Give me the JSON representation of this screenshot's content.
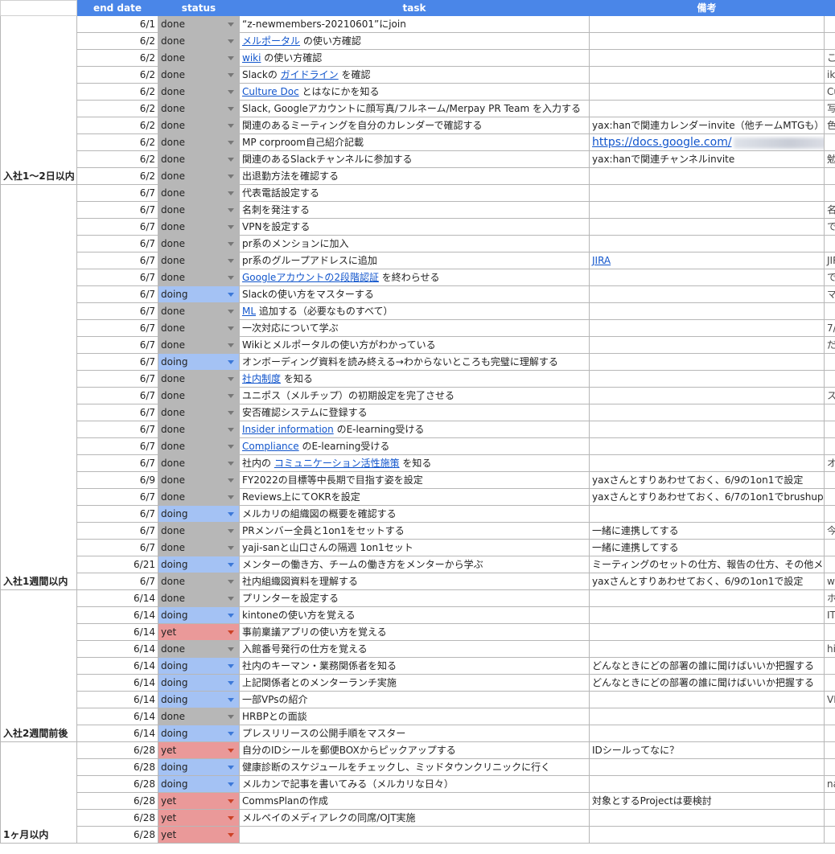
{
  "headers": {
    "end_date": "end date",
    "status": "status",
    "task": "task",
    "note": "備考"
  },
  "colors": {
    "header": "#4a86e8",
    "done": "#b7b7b7",
    "doing": "#a4c2f4",
    "yet": "#ea9999",
    "link": "#1155cc"
  },
  "groups": [
    {
      "label": "入社1〜2日以内",
      "rows": [
        {
          "date": "6/1",
          "status": "done",
          "task": [
            {
              "t": "“z-newmembers-20210601”にjoin"
            }
          ],
          "note": "",
          "extra": ""
        },
        {
          "date": "6/2",
          "status": "done",
          "task": [
            {
              "t": "メルポータル",
              "link": true
            },
            {
              "t": " の使い方確認"
            }
          ],
          "note": "",
          "extra": ""
        },
        {
          "date": "6/2",
          "status": "done",
          "task": [
            {
              "t": "wiki",
              "link": true
            },
            {
              "t": " の使い方確認"
            }
          ],
          "note": "",
          "extra": "こ"
        },
        {
          "date": "6/2",
          "status": "done",
          "task": [
            {
              "t": "Slackの "
            },
            {
              "t": "ガイドライン",
              "link": true
            },
            {
              "t": " を確認"
            }
          ],
          "note": "",
          "extra": "iku"
        },
        {
          "date": "6/2",
          "status": "done",
          "task": [
            {
              "t": " Culture Doc",
              "link": true
            },
            {
              "t": " とはなにかを知る"
            }
          ],
          "note": "",
          "extra": "Cu"
        },
        {
          "date": "6/2",
          "status": "done",
          "task": [
            {
              "t": "Slack, Googleアカウントに顔写真/フルネーム/Merpay PR Team を入力する"
            }
          ],
          "note": "",
          "extra": "写"
        },
        {
          "date": "6/2",
          "status": "done",
          "task": [
            {
              "t": "関連のあるミーティングを自分のカレンダーで確認する"
            }
          ],
          "note": "yax:hanで関連カレンダーinvite（他チームMTGも）",
          "extra": "色"
        },
        {
          "date": "6/2",
          "status": "done",
          "task": [
            {
              "t": "MP corproom自己紹介記載"
            }
          ],
          "note_link": "https://docs.google.com/",
          "note": "",
          "extra": ""
        },
        {
          "date": "6/2",
          "status": "done",
          "task": [
            {
              "t": "関連のあるSlackチャンネルに参加する"
            }
          ],
          "note": "yax:hanで関連チャンネルinvite",
          "extra": "勉"
        },
        {
          "date": "6/2",
          "status": "done",
          "task": [
            {
              "t": "出退勤方法を確認する"
            }
          ],
          "note": "",
          "extra": ""
        }
      ]
    },
    {
      "label": "入社1週間以内",
      "rows": [
        {
          "date": "6/7",
          "status": "done",
          "task": [
            {
              "t": "代表電話設定する"
            }
          ],
          "note": "",
          "extra": ""
        },
        {
          "date": "6/7",
          "status": "done",
          "task": [
            {
              "t": "名刺を発注する"
            }
          ],
          "note": "",
          "extra": "名"
        },
        {
          "date": "6/7",
          "status": "done",
          "task": [
            {
              "t": "VPNを設定する"
            }
          ],
          "note": "",
          "extra": "で"
        },
        {
          "date": "6/7",
          "status": "done",
          "task": [
            {
              "t": "pr系のメンションに加入"
            }
          ],
          "note": "",
          "extra": ""
        },
        {
          "date": "6/7",
          "status": "done",
          "task": [
            {
              "t": "pr系のグループアドレスに追加"
            }
          ],
          "note_link": "JIRA",
          "note": "",
          "extra": "JIR"
        },
        {
          "date": "6/7",
          "status": "done",
          "task": [
            {
              "t": "Googleアカウントの2段階認証",
              "link": true
            },
            {
              "t": " を終わらせる"
            }
          ],
          "note": "",
          "extra": "で"
        },
        {
          "date": "6/7",
          "status": "doing",
          "task": [
            {
              "t": "Slackの使い方をマスターする"
            }
          ],
          "note": "",
          "extra": "マ"
        },
        {
          "date": "6/7",
          "status": "done",
          "task": [
            {
              "t": "ML",
              "link": true
            },
            {
              "t": " 追加する（必要なものすべて）"
            }
          ],
          "note": "",
          "extra": ""
        },
        {
          "date": "6/7",
          "status": "done",
          "task": [
            {
              "t": "一次対応について学ぶ"
            }
          ],
          "note": "",
          "extra": "7/"
        },
        {
          "date": "6/7",
          "status": "done",
          "task": [
            {
              "t": "Wikiとメルポータルの使い方がわかっている"
            }
          ],
          "note": "",
          "extra": "だ"
        },
        {
          "date": "6/7",
          "status": "doing",
          "task": [
            {
              "t": "オンボーディング資料を読み終える→わからないところも完璧に理解する"
            }
          ],
          "note": "",
          "extra": ""
        },
        {
          "date": "6/7",
          "status": "done",
          "task": [
            {
              "t": "社内制度",
              "link": true
            },
            {
              "t": " を知る"
            }
          ],
          "note": "",
          "extra": ""
        },
        {
          "date": "6/7",
          "status": "done",
          "task": [
            {
              "t": "ユニポス（メルチップ）の初期設定を完了させる"
            }
          ],
          "note": "",
          "extra": "ス"
        },
        {
          "date": "6/7",
          "status": "done",
          "task": [
            {
              "t": "安否確認システムに登録する"
            }
          ],
          "note": "",
          "extra": ""
        },
        {
          "date": "6/7",
          "status": "done",
          "task": [
            {
              "t": "Insider information",
              "link": true
            },
            {
              "t": " のE-learning受ける"
            }
          ],
          "note": "",
          "extra": ""
        },
        {
          "date": "6/7",
          "status": "done",
          "task": [
            {
              "t": "Compliance",
              "link": true
            },
            {
              "t": " のE-learning受ける"
            }
          ],
          "note": "",
          "extra": ""
        },
        {
          "date": "6/7",
          "status": "done",
          "task": [
            {
              "t": "社内の "
            },
            {
              "t": "コミュニケーション活性施策",
              "link": true
            },
            {
              "t": " を知る"
            }
          ],
          "note": "",
          "extra": "オ"
        },
        {
          "date": "6/9",
          "status": "done",
          "task": [
            {
              "t": "FY2022の目標等中長期で目指す姿を設定"
            }
          ],
          "note": "yaxさんとすりあわせておく、6/9の1on1で設定",
          "extra": ""
        },
        {
          "date": "6/7",
          "status": "done",
          "task": [
            {
              "t": "Reviews上にてOKRを設定"
            }
          ],
          "note": "yaxさんとすりあわせておく、6/7の1on1でbrushup",
          "extra": ""
        },
        {
          "date": "6/7",
          "status": "doing",
          "task": [
            {
              "t": "メルカリの組織図の概要を確認する"
            }
          ],
          "note": "",
          "extra": ""
        },
        {
          "date": "6/7",
          "status": "done",
          "task": [
            {
              "t": "PRメンバー全員と1on1をセットする"
            }
          ],
          "note": "一緒に連携してする",
          "extra": "今"
        },
        {
          "date": "6/7",
          "status": "done",
          "task": [
            {
              "t": "yaji-sanと山口さんの隔週 1on1セット"
            }
          ],
          "note": "一緒に連携してする",
          "extra": ""
        },
        {
          "date": "6/21",
          "status": "doing",
          "tall": true,
          "task": [
            {
              "t": "メンターの働き方、チームの働き方をメンターから学ぶ"
            }
          ],
          "note": "ミーティングのセットの仕方、報告の仕方、その他メンバ",
          "extra": ""
        },
        {
          "date": "6/7",
          "status": "done",
          "task": [
            {
              "t": "社内組織図資料を理解する"
            }
          ],
          "note": "yaxさんとすりあわせておく、6/9の1on1で設定",
          "extra": "wo"
        }
      ]
    },
    {
      "label": "入社2週間前後",
      "rows": [
        {
          "date": "6/14",
          "status": "done",
          "task": [
            {
              "t": "プリンターを設定する"
            }
          ],
          "note": "",
          "extra": "ホ"
        },
        {
          "date": "6/14",
          "status": "doing",
          "task": [
            {
              "t": "kintoneの使い方を覚える"
            }
          ],
          "note": "",
          "extra": "IT"
        },
        {
          "date": "6/14",
          "status": "yet",
          "task": [
            {
              "t": "事前稟議アプリの使い方を覚える"
            }
          ],
          "note": "",
          "extra": ""
        },
        {
          "date": "6/14",
          "status": "done",
          "task": [
            {
              "t": "入館番号発行の仕方を覚える"
            }
          ],
          "note": "",
          "extra": "his"
        },
        {
          "date": "6/14",
          "status": "doing",
          "task": [
            {
              "t": "社内のキーマン・業務関係者を知る"
            }
          ],
          "note": "どんなときにどの部署の誰に聞けばいいか把握する",
          "extra": ""
        },
        {
          "date": "6/14",
          "status": "doing",
          "task": [
            {
              "t": "上記関係者とのメンターランチ実施"
            }
          ],
          "note": "どんなときにどの部署の誰に聞けばいいか把握する",
          "extra": ""
        },
        {
          "date": "6/14",
          "status": "doing",
          "task": [
            {
              "t": "一部VPsの紹介"
            }
          ],
          "note": "",
          "extra": "VP"
        },
        {
          "date": "6/14",
          "status": "done",
          "task": [
            {
              "t": "HRBPとの面談"
            }
          ],
          "note": "",
          "extra": ""
        },
        {
          "date": "6/14",
          "status": "doing",
          "task": [
            {
              "t": "プレスリリースの公開手順をマスター"
            }
          ],
          "note": "",
          "extra": ""
        }
      ]
    },
    {
      "label": "1ヶ月以内",
      "rows": [
        {
          "date": "6/28",
          "status": "yet",
          "task": [
            {
              "t": "自分のIDシールを郵便BOXからピックアップする"
            }
          ],
          "note": "IDシールってなに？",
          "extra": ""
        },
        {
          "date": "6/28",
          "status": "doing",
          "task": [
            {
              "t": "健康診断のスケジュールをチェックし、ミッドタウンクリニックに行く"
            }
          ],
          "note": "",
          "extra": ""
        },
        {
          "date": "6/28",
          "status": "doing",
          "task": [
            {
              "t": "メルカンで記事を書いてみる（メルカリな日々）"
            }
          ],
          "note": "",
          "extra": "na"
        },
        {
          "date": "6/28",
          "status": "yet",
          "task": [
            {
              "t": "CommsPlanの作成"
            }
          ],
          "note": "対象とするProjectは要検討",
          "extra": ""
        },
        {
          "date": "6/28",
          "status": "yet",
          "task": [
            {
              "t": "メルペイのメディアレクの同席/OJT実施"
            }
          ],
          "note": "",
          "extra": ""
        },
        {
          "date": "6/28",
          "status": "yet",
          "task": [],
          "note": "",
          "extra": ""
        }
      ]
    }
  ]
}
